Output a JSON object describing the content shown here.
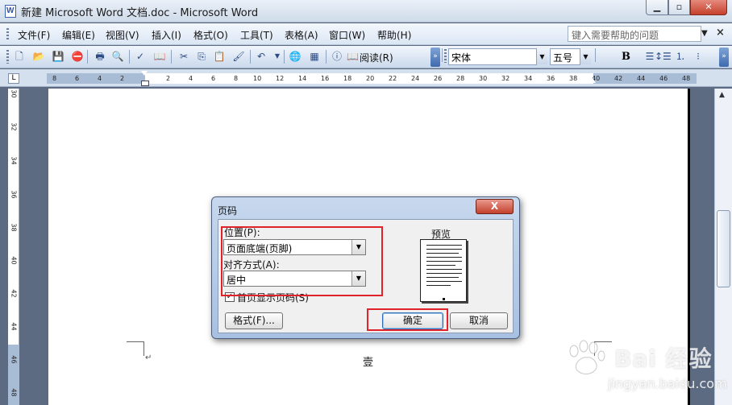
{
  "window": {
    "title": "新建 Microsoft Word 文档.doc - Microsoft Word"
  },
  "menu": {
    "items": [
      "文件(F)",
      "编辑(E)",
      "视图(V)",
      "插入(I)",
      "格式(O)",
      "工具(T)",
      "表格(A)",
      "窗口(W)",
      "帮助(H)"
    ],
    "help_placeholder": "键入需要帮助的问题"
  },
  "toolbar": {
    "read_label": "阅读(R)",
    "font_name": "宋体",
    "font_size": "五号",
    "bold_label": "B"
  },
  "ruler": {
    "h_ticks": [
      "8",
      "6",
      "4",
      "2",
      "2",
      "4",
      "6",
      "8",
      "10",
      "12",
      "14",
      "16",
      "18",
      "20",
      "22",
      "24",
      "26",
      "28",
      "30",
      "32",
      "34",
      "36",
      "38",
      "40",
      "42",
      "44",
      "46",
      "48"
    ],
    "v_ticks": [
      "30",
      "32",
      "34",
      "36",
      "38",
      "40",
      "42",
      "44",
      "46",
      "48"
    ]
  },
  "document": {
    "footer_text": "壹"
  },
  "dialog": {
    "title": "页码",
    "close_label": "X",
    "position_label": "位置(P):",
    "position_value": "页面底端(页脚)",
    "alignment_label": "对齐方式(A):",
    "alignment_value": "居中",
    "first_page_label": "首页显示页码(S)",
    "first_page_checked": true,
    "preview_label": "预览",
    "format_button": "格式(F)...",
    "ok_button": "确定",
    "cancel_button": "取消"
  },
  "watermark": {
    "text": "Bai 经验",
    "url": "jingyan.baidu.com"
  },
  "colors": {
    "highlight": "#e0232b",
    "title_gradient_top": "#e9f0f8",
    "workspace": "#5c6a82"
  }
}
